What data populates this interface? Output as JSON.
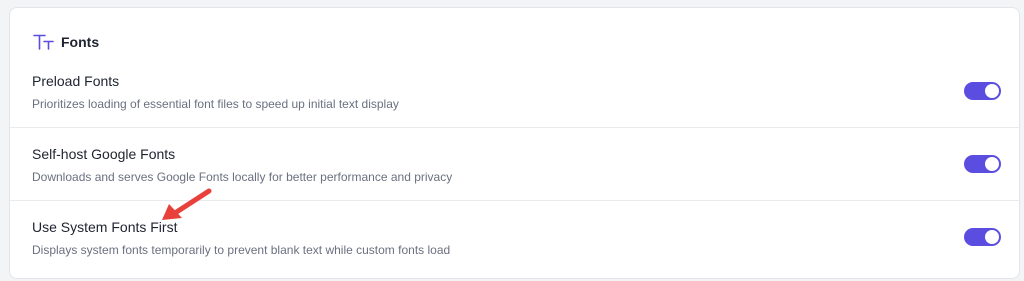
{
  "section": {
    "title": "Fonts",
    "icon": "font-size-icon"
  },
  "settings": [
    {
      "title": "Preload Fonts",
      "description": "Prioritizes loading of essential font files to speed up initial text display",
      "enabled": true
    },
    {
      "title": "Self-host Google Fonts",
      "description": "Downloads and serves Google Fonts locally for better performance and privacy",
      "enabled": true
    },
    {
      "title": "Use System Fonts First",
      "description": "Displays system fonts temporarily to prevent blank text while custom fonts load",
      "enabled": true
    }
  ],
  "colors": {
    "accent": "#5b4de0",
    "annotation_arrow": "#e8403a"
  }
}
